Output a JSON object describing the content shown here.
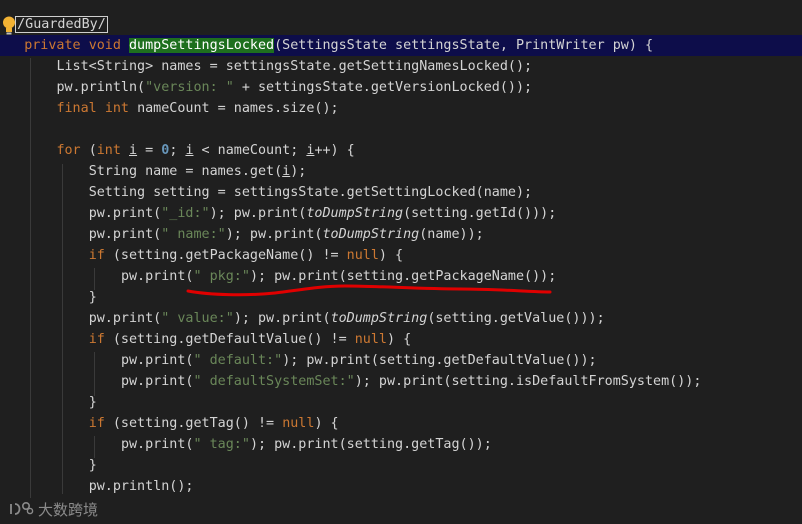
{
  "code": {
    "l1_annotation": "/GuardedBy/",
    "l2_private": "private ",
    "l2_void": "void ",
    "l2_method": "dumpSettingsLocked",
    "l2_rest": "(SettingsState settingsState, PrintWriter pw) {",
    "l3": "List<String> names = settingsState.getSettingNamesLocked();",
    "l4_a": "pw.println(",
    "l4_str": "\"version: \"",
    "l4_b": " + settingsState.getVersionLocked());",
    "l5_final": "final ",
    "l5_int": "int ",
    "l5_rest": "nameCount = names.size();",
    "l7_for": "for ",
    "l7_a": "(",
    "l7_int": "int ",
    "l7_i1": "i",
    "l7_b": " = ",
    "l7_zero": "0",
    "l7_c": "; ",
    "l7_i2": "i",
    "l7_d": " < nameCount; ",
    "l7_i3": "i",
    "l7_e": "++) {",
    "l8_a": "String name = names.get(",
    "l8_i": "i",
    "l8_b": ");",
    "l9": "Setting setting = settingsState.getSettingLocked(name);",
    "l10_a": "pw.print(",
    "l10_str": "\"_id:\"",
    "l10_b": "); pw.print(",
    "l10_fn": "toDumpString",
    "l10_c": "(setting.getId()));",
    "l11_a": "pw.print(",
    "l11_str": "\" name:\"",
    "l11_b": "); pw.print(",
    "l11_fn": "toDumpString",
    "l11_c": "(name));",
    "l12_if": "if ",
    "l12_a": "(setting.getPackageName() != ",
    "l12_null": "null",
    "l12_b": ") {",
    "l13_a": "pw.print(",
    "l13_str": "\" pkg:\"",
    "l13_b": "); pw.print(setting.getPackageName());",
    "l14": "}",
    "l15_a": "pw.print(",
    "l15_str": "\" value:\"",
    "l15_b": "); pw.print(",
    "l15_fn": "toDumpString",
    "l15_c": "(setting.getValue()));",
    "l16_if": "if ",
    "l16_a": "(setting.getDefaultValue() != ",
    "l16_null": "null",
    "l16_b": ") {",
    "l17_a": "pw.print(",
    "l17_str": "\" default:\"",
    "l17_b": "); pw.print(setting.getDefaultValue());",
    "l18_a": "pw.print(",
    "l18_str": "\" defaultSystemSet:\"",
    "l18_b": "); pw.print(setting.isDefaultFromSystem());",
    "l19": "}",
    "l20_if": "if ",
    "l20_a": "(setting.getTag() != ",
    "l20_null": "null",
    "l20_b": ") {",
    "l21_a": "pw.print(",
    "l21_str": "\" tag:\"",
    "l21_b": "); pw.print(setting.getTag());",
    "l22": "}",
    "l23": "pw.println();"
  },
  "watermark": {
    "text": "大数跨境"
  },
  "colors": {
    "background": "#1f1f1f",
    "keyword": "#cc7832",
    "string": "#6a8759",
    "number": "#6897bb",
    "highlight_line": "#0d0d4a",
    "method_highlight": "#1e6f1e",
    "annotation_squiggle": "#e00000"
  },
  "icons": {
    "gutter": "lightbulb-icon",
    "watermark": "logo-icon"
  }
}
